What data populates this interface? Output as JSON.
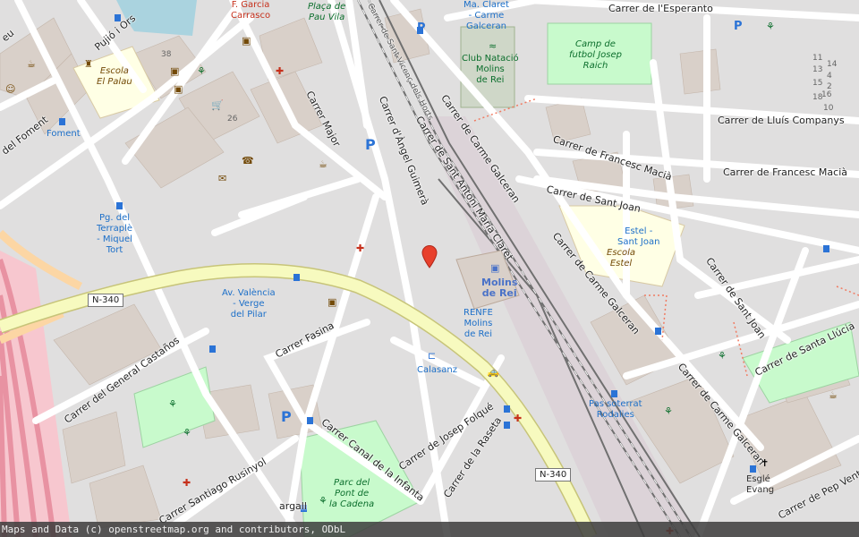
{
  "map": {
    "attribution": "Maps and Data (c) openstreetmap.org and contributors, ODbL",
    "streets": {
      "esperanto": "Carrer de l'Esperanto",
      "lluis_companys": "Carrer de Lluís Companys",
      "francesc_macia_1": "Carrer de Francesc Macià",
      "francesc_macia_2": "Carrer de Francesc Macià",
      "sant_joan_1": "Carrer de Sant Joan",
      "sant_joan_2": "Carrer de Sant Joan",
      "carme_galceran_1": "Carrer de Carme Galceran",
      "carme_galceran_2": "Carrer de Carme Galceran",
      "carme_galceran_3": "Carrer de Carme Galceran",
      "sant_antoni": "Carrer de Sant Antoni Maria Claret",
      "angel_guimera": "Carrer d'Àngel Guimerà",
      "major": "Carrer Major",
      "santa_llucia": "Carrer de Santa Llúcia",
      "pep_ventura": "Carrer de Pep Ventura",
      "foment": "del Foment",
      "ors": "Pujió i Ors",
      "fasina": "Carrer Fasina",
      "general_castanos": "Carrer del General Castaños",
      "santiago_rusinyol": "Carrer Santiago Rusinyol",
      "josep_folque": "Carrer de Josep Folqué",
      "raseta": "Carrer de la Raseta",
      "canal_infanta": "Carrer Canal de la Infanta",
      "bonavall_bottom": "argall",
      "feu": "eu",
      "sant_vicenc": "Carrer de Sant Vicenç dels Horts"
    },
    "routes": {
      "n340_left": "N-340",
      "n340_right": "N-340"
    },
    "places": {
      "f_garcia": "F. Garcia\nCarrasco",
      "placa_pau_vila": "Plaça de\nPau Vila",
      "ma_claret": "Ma. Claret\n- Carme\nGalceran",
      "club_natacio": "Club Natació\nMolins\nde Rei",
      "camp_futbol": "Camp de\nfutbol Josep\nRaich",
      "escola_palau": "Escola\nEl Palau",
      "foment_stop": "Foment",
      "pg_terraple": "Pg. del\nTerraplè\n- Miquel\nTort",
      "av_valencia": "Av. València\n- Verge\ndel Pilar",
      "estel_sant_joan": "Estel -\nSant Joan",
      "escola_estel": "Escola\nEstel",
      "molins_de_rei": "Molins\nde Rei",
      "renfe": "RENFE\nMolins\nde Rei",
      "calasanz": "Calasanz",
      "pas_soterrat": "Pas soterrat\nRodalies",
      "parc_pont": "Parc del\nPont de\nla Cadena",
      "esglesia": "Esglé\nEvang",
      "house_numbers": [
        "38",
        "26",
        "11",
        "13",
        "14",
        "15",
        "16",
        "18",
        "10",
        "2",
        "4"
      ]
    },
    "colors": {
      "background": "#f2efe9",
      "residential": "#e0dfdf",
      "building": "#d9d0c9",
      "road": "#ffffff",
      "trunk": "#f7fabf",
      "trunk_border": "#c7c479",
      "motorway": "#e892a2",
      "primary": "#fcd6a4",
      "park": "#c8facc",
      "school": "#ffffe5",
      "rail": "#707070",
      "pin": "#e8402c"
    },
    "icons": [
      "parking",
      "bus-stop",
      "pharmacy",
      "post-office",
      "playground",
      "tree",
      "taxi",
      "church",
      "cafe",
      "theatre",
      "bank",
      "shop",
      "train-station"
    ]
  }
}
